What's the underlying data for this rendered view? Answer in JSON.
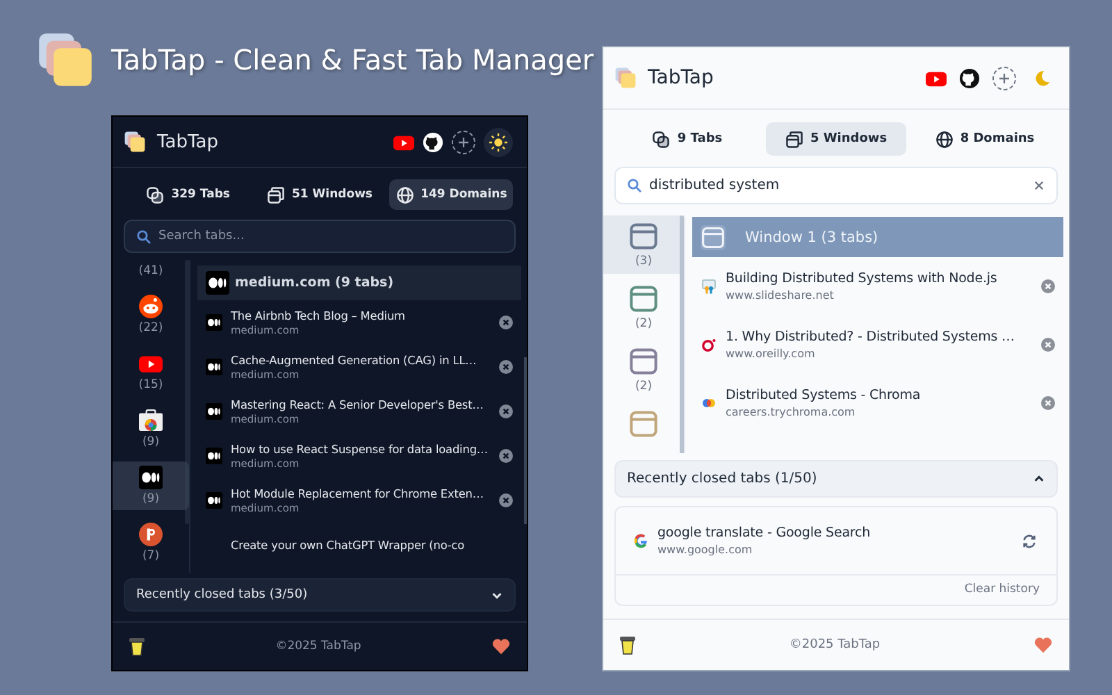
{
  "header": {
    "title": "TabTap - Clean & Fast Tab Manager"
  },
  "panels": [
    {
      "dark_mode": true,
      "app_name": "TabTap",
      "stats": [
        {
          "kind": "tabs",
          "label": "329 Tabs",
          "selected": false
        },
        {
          "kind": "windows",
          "label": "51 Windows",
          "selected": false
        },
        {
          "kind": "domains",
          "label": "149 Domains",
          "selected": true
        }
      ],
      "search": {
        "placeholder": "Search tabs..."
      },
      "sidebar": [
        {
          "kind": "none",
          "count": "(41)",
          "selected": false
        },
        {
          "kind": "reddit",
          "count": "(22)",
          "selected": false
        },
        {
          "kind": "youtube",
          "count": "(15)",
          "selected": false
        },
        {
          "kind": "store",
          "count": "(9)",
          "selected": false
        },
        {
          "kind": "medium",
          "count": "(9)",
          "selected": true
        },
        {
          "kind": "producthunt",
          "count": "(7)",
          "selected": false
        }
      ],
      "group": {
        "kind": "medium",
        "title": "medium.com (9 tabs)"
      },
      "tabs": [
        {
          "kind": "medium",
          "title": "The Airbnb Tech Blog – Medium",
          "url": "medium.com"
        },
        {
          "kind": "medium",
          "title": "Cache-Augmented Generation (CAG) in LL…",
          "url": "medium.com"
        },
        {
          "kind": "medium",
          "title": "Mastering React: A Senior Developer's Best…",
          "url": "medium.com"
        },
        {
          "kind": "medium",
          "title": "How to use React Suspense for data loading…",
          "url": "medium.com"
        },
        {
          "kind": "medium",
          "title": "Hot Module Replacement for Chrome Exten…",
          "url": "medium.com"
        },
        {
          "kind": "none",
          "title": "Create your own ChatGPT Wrapper (no-co"
        }
      ],
      "recently_closed": {
        "label": "Recently closed tabs (3/50)",
        "expanded": false
      },
      "footer": {
        "copyright": "©2025 TabTap"
      }
    },
    {
      "dark_mode": false,
      "app_name": "TabTap",
      "stats": [
        {
          "kind": "tabs",
          "label": "9 Tabs",
          "selected": false
        },
        {
          "kind": "windows",
          "label": "5 Windows",
          "selected": true
        },
        {
          "kind": "domains",
          "label": "8 Domains",
          "selected": false
        }
      ],
      "search": {
        "value": "distributed system"
      },
      "sidebar": [
        {
          "kind": "window",
          "color": "#6b7a90",
          "count": "(3)",
          "selected": true
        },
        {
          "kind": "window",
          "color": "#5f8f80",
          "count": "(2)",
          "selected": false
        },
        {
          "kind": "window",
          "color": "#86809a",
          "count": "(2)",
          "selected": false
        },
        {
          "kind": "window",
          "color": "#c0a57a",
          "selected": false
        }
      ],
      "group": {
        "kind": "window",
        "title": "Window 1 (3 tabs)"
      },
      "tabs": [
        {
          "kind": "slideshare",
          "title": "Building Distributed Systems with Node.js",
          "url": "www.slideshare.net"
        },
        {
          "kind": "oreilly",
          "title": "1. Why Distributed? - Distributed Systems …",
          "url": "www.oreilly.com"
        },
        {
          "kind": "chroma",
          "title": "Distributed Systems - Chroma",
          "url": "careers.trychroma.com"
        }
      ],
      "recently_closed": {
        "label": "Recently closed tabs (1/50)",
        "expanded": true,
        "items": [
          {
            "kind": "google",
            "title": "google translate - Google Search",
            "url": "www.google.com"
          }
        ],
        "clear_label": "Clear history"
      },
      "footer": {
        "copyright": "©2025 TabTap"
      }
    }
  ]
}
